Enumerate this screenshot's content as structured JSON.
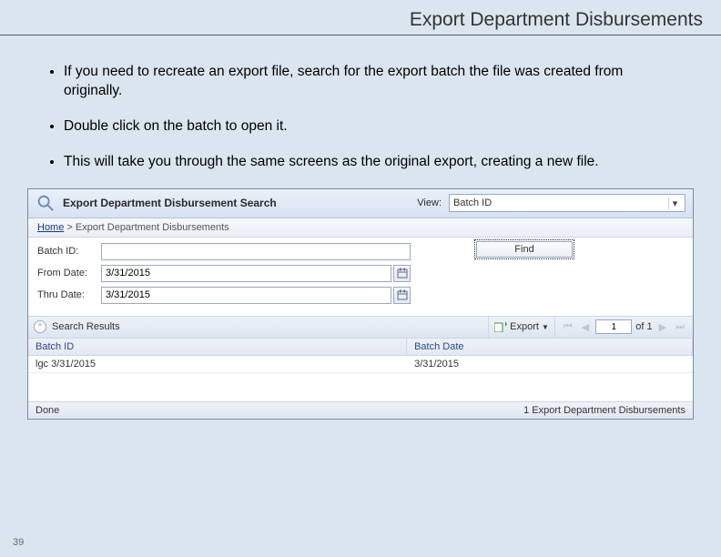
{
  "slide": {
    "title": "Export Department Disbursements",
    "bullets": [
      "If you need to recreate an export file, search for the export batch the file was created from originally.",
      "Double click on the batch to open it.",
      "This will take you through the same screens as the original export, creating a new file."
    ],
    "page_number": "39"
  },
  "app": {
    "header_title": "Export Department Disbursement Search",
    "view_label": "View:",
    "view_selected": "Batch ID",
    "breadcrumb_home": "Home",
    "breadcrumb_sep": ">",
    "breadcrumb_current": "Export Department Disbursements",
    "form": {
      "batch_label": "Batch ID:",
      "batch_value": "",
      "from_label": "From Date:",
      "from_value": "3/31/2015",
      "thru_label": "Thru Date:",
      "thru_value": "3/31/2015",
      "find_label": "Find"
    },
    "toolbar": {
      "results_label": "Search Results",
      "export_label": "Export",
      "page_current": "1",
      "page_of": "of 1"
    },
    "grid": {
      "col_a": "Batch ID",
      "col_b": "Batch Date",
      "row0_a": "lgc   3/31/2015",
      "row0_b": "3/31/2015"
    },
    "status": {
      "left": "Done",
      "right": "1 Export Department Disbursements"
    }
  }
}
